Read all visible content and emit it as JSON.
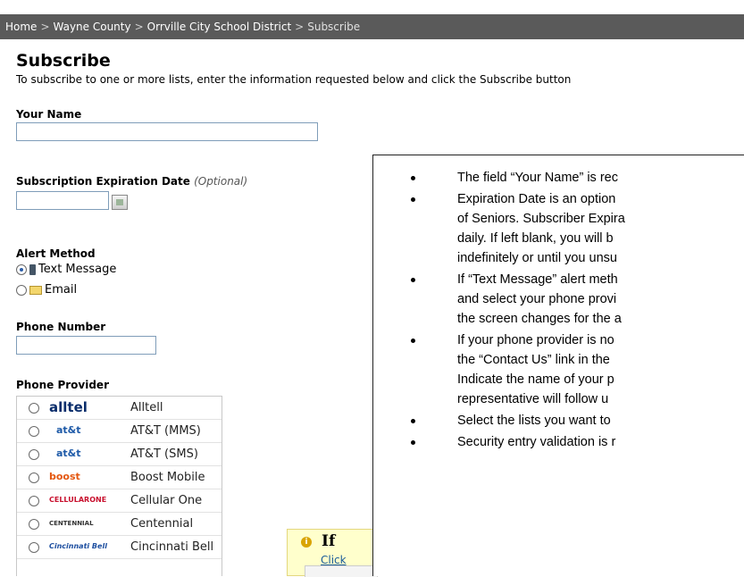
{
  "breadcrumb": {
    "home": "Home",
    "county": "Wayne County",
    "district": "Orrville City School District",
    "current": "Subscribe",
    "separator": ">"
  },
  "page": {
    "title": "Subscribe",
    "intro": "To subscribe to one or more lists, enter the information requested below and click the Subscribe button"
  },
  "form": {
    "name_label": "Your Name",
    "name_value": "",
    "expiration_label": "Subscription Expiration Date",
    "expiration_optional": "(Optional)",
    "expiration_value": "",
    "alert_method_label": "Alert Method",
    "alert_options": [
      {
        "label": "Text Message",
        "selected": true,
        "icon": "mobile-phone-icon"
      },
      {
        "label": "Email",
        "selected": false,
        "icon": "envelope-icon"
      }
    ],
    "phone_number_label": "Phone Number",
    "phone_number_value": "",
    "phone_provider_label": "Phone Provider",
    "providers": [
      {
        "logo": "alltel",
        "name": "Alltell",
        "logo_color": "#0a2d6b"
      },
      {
        "logo": "at&t",
        "name": "AT&T (MMS)",
        "logo_color": "#1e5aa8"
      },
      {
        "logo": "at&t",
        "name": "AT&T (SMS)",
        "logo_color": "#1e5aa8"
      },
      {
        "logo": "boost",
        "name": "Boost Mobile",
        "logo_color": "#e4570f"
      },
      {
        "logo": "CELLULARONE",
        "name": "Cellular One",
        "logo_color": "#c8102e"
      },
      {
        "logo": "CENTENNIAL",
        "name": "Centennial",
        "logo_color": "#333333"
      },
      {
        "logo": "Cincinnati Bell",
        "name": "Cincinnati Bell",
        "logo_color": "#1e4fa0"
      }
    ]
  },
  "notice": {
    "title": "If",
    "link": "Click"
  },
  "overlay": {
    "bullets": [
      [
        "The field “Your Name” is rec"
      ],
      [
        "Expiration Date is an option",
        "of Seniors. Subscriber Expira",
        "daily. If left blank, you will b",
        "indefinitely or until you unsu"
      ],
      [
        "If “Text Message” alert meth",
        "and select your phone provi",
        "the screen changes for the a"
      ],
      [
        "If your phone provider is no",
        "the “Contact Us” link in the",
        "Indicate the name of your p",
        "representative will follow u"
      ],
      [
        "Select the lists you want to"
      ],
      [
        "Security entry validation is r"
      ]
    ]
  },
  "colors": {
    "breadcrumb_bg": "#5a5a5a",
    "notice_bg": "#ffffcc",
    "link": "#1a5c9a",
    "input_border": "#7f9db9"
  }
}
